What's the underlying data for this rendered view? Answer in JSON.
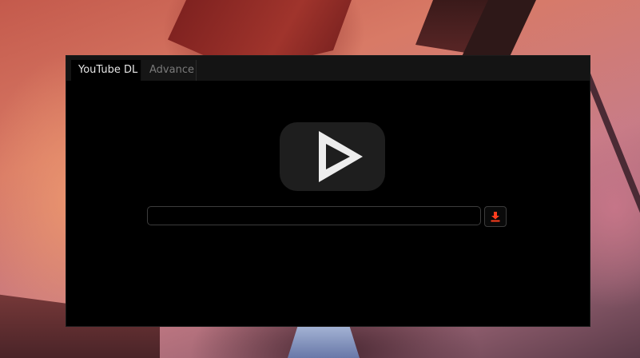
{
  "tabs": [
    {
      "label": "YouTube DL",
      "active": true
    },
    {
      "label": "Advance",
      "active": false
    }
  ],
  "main": {
    "logo_icon": "youtube-play-icon",
    "url_input": {
      "value": "",
      "placeholder": ""
    },
    "download_button": {
      "icon": "download-icon",
      "icon_color": "#ff3d1e"
    }
  },
  "colors": {
    "window_bg": "#000000",
    "tabbar_bg": "#141414",
    "active_tab_text": "#e6e6e6",
    "inactive_tab_text": "#7a7a7a",
    "logo_bg": "#1e1e1e",
    "logo_play": "#ededed",
    "accent": "#ff3d1e"
  }
}
